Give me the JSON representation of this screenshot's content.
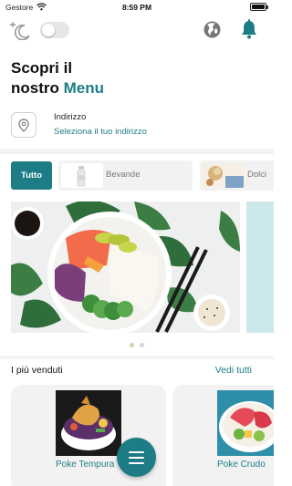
{
  "status_bar": {
    "carrier": "Gestore",
    "time": "8:59 PM",
    "battery_level": 1.0
  },
  "header": {
    "theme_toggle": {
      "on": false
    },
    "icons": [
      "moon-icon",
      "globe-icon",
      "bell-icon"
    ]
  },
  "title": {
    "line1": "Scopri il",
    "line2_plain": "nostro",
    "line2_accent": "Menu"
  },
  "address": {
    "label": "Indirizzo",
    "link": "Seleziona il tuo indirizzo"
  },
  "categories": {
    "all_label": "Tutto",
    "items": [
      {
        "label": "Bevande",
        "icon": "bottle-icon"
      },
      {
        "label": "Dolci",
        "icon": "dessert-icon"
      }
    ]
  },
  "carousel": {
    "slides": 2,
    "active_index": 0
  },
  "bestsellers": {
    "title": "I più venduti",
    "link": "Vedi tutti",
    "items": [
      {
        "name": "Poke Tempura"
      },
      {
        "name": "Poke Crudo"
      }
    ]
  },
  "colors": {
    "accent": "#1e7c86",
    "chip_bg": "#f2f2f2",
    "bell": "#1e7c86"
  }
}
